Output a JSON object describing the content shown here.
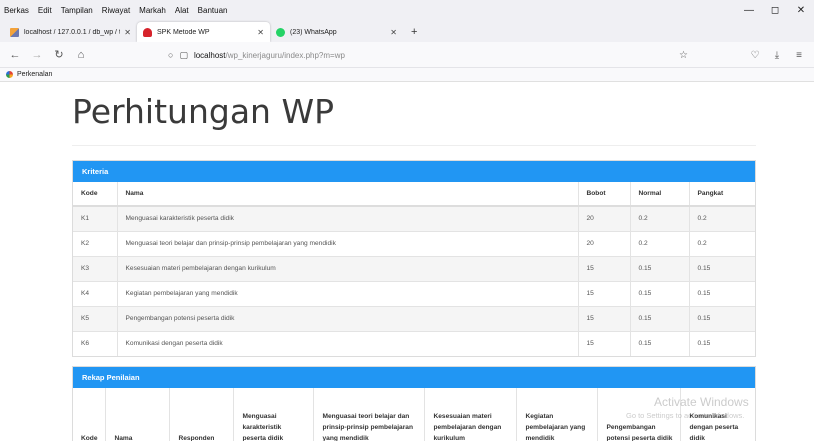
{
  "browser": {
    "menu": [
      "Berkas",
      "Edit",
      "Tampilan",
      "Riwayat",
      "Markah",
      "Alat",
      "Bantuan"
    ],
    "window_controls": [
      "—",
      "◻",
      "✕"
    ],
    "tabs": [
      {
        "label": "localhost / 127.0.0.1 / db_wp / tabe",
        "favicon": "phpmyadmin-icon",
        "active": false
      },
      {
        "label": "SPK Metode WP",
        "favicon": "spk-icon",
        "active": true
      },
      {
        "label": "(23) WhatsApp",
        "favicon": "whatsapp-icon",
        "active": false
      }
    ],
    "new_tab_label": "+",
    "url_host": "localhost",
    "url_path": "/wp_kinerjaguru/index.php?m=wp",
    "bookmark": "Perkenalan"
  },
  "page": {
    "title": "Perhitungan WP"
  },
  "kriteria": {
    "heading": "Kriteria",
    "columns": [
      "Kode",
      "Nama",
      "Bobot",
      "Normal",
      "Pangkat"
    ],
    "rows": [
      [
        "K1",
        "Menguasai karakteristik peserta didik",
        "20",
        "0.2",
        "0.2"
      ],
      [
        "K2",
        "Menguasai teori belajar dan prinsip-prinsip pembelajaran yang mendidik",
        "20",
        "0.2",
        "0.2"
      ],
      [
        "K3",
        "Kesesuaian materi pembelajaran dengan kurikulum",
        "15",
        "0.15",
        "0.15"
      ],
      [
        "K4",
        "Kegiatan pembelajaran yang mendidik",
        "15",
        "0.15",
        "0.15"
      ],
      [
        "K5",
        "Pengembangan potensi peserta didik",
        "15",
        "0.15",
        "0.15"
      ],
      [
        "K6",
        "Komunikasi dengan peserta didik",
        "15",
        "0.15",
        "0.15"
      ]
    ]
  },
  "rekap": {
    "heading": "Rekap Penilaian",
    "columns": [
      "Kode",
      "Nama",
      "Responden",
      "Menguasai karakteristik peserta didik",
      "Menguasai teori belajar dan prinsip-prinsip pembelajaran yang mendidik",
      "Kesesuaian materi pembelajaran dengan kurikulum",
      "Kegiatan pembelajaran yang mendidik",
      "Pengembangan potensi peserta didik",
      "Komunikasi dengan peserta didik"
    ]
  },
  "watermark": {
    "line1": "Activate Windows",
    "line2": "Go to Settings to activate Windows."
  },
  "colors": {
    "panel_heading": "#2196f3",
    "stripe": "#f5f5f5"
  }
}
